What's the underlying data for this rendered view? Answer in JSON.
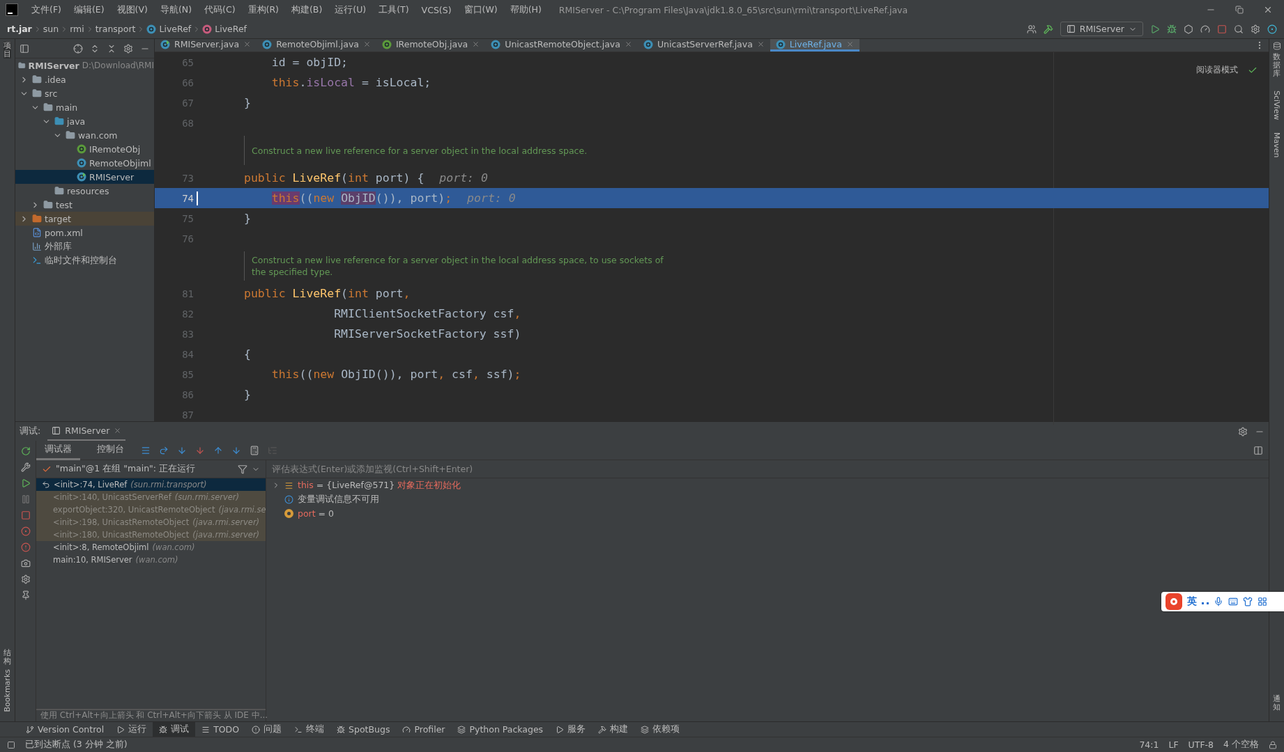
{
  "menu": {
    "items": [
      "文件(F)",
      "编辑(E)",
      "视图(V)",
      "导航(N)",
      "代码(C)",
      "重构(R)",
      "构建(B)",
      "运行(U)",
      "工具(T)",
      "VCS(S)",
      "窗口(W)",
      "帮助(H)"
    ],
    "title": "RMIServer - C:\\Program Files\\Java\\jdk1.8.0_65\\src\\sun\\rmi\\transport\\LiveRef.java"
  },
  "breadcrumb": [
    {
      "kind": "jar",
      "label": "rt.jar"
    },
    {
      "kind": "plain",
      "label": "sun"
    },
    {
      "kind": "plain",
      "label": "rmi"
    },
    {
      "kind": "plain",
      "label": "transport"
    },
    {
      "kind": "class",
      "label": "LiveRef"
    },
    {
      "kind": "method",
      "label": "LiveRef"
    }
  ],
  "run_config": "RMIServer",
  "left_strip": {
    "top": "项目",
    "middle": "结构",
    "bottom": "Bookmarks"
  },
  "right_strip": [
    "数据库",
    "SciView",
    "Maven"
  ],
  "right_notify": "通知",
  "project": {
    "root": {
      "label": "RMIServer",
      "path": "D:\\Download\\RMI"
    },
    "tree": [
      {
        "label": ".idea",
        "kind": "folder",
        "expanded": false,
        "selected": false
      },
      {
        "label": "src",
        "kind": "folder",
        "expanded": true,
        "selected": false,
        "children": [
          {
            "label": "main",
            "kind": "folder",
            "expanded": true,
            "selected": false,
            "children": [
              {
                "label": "java",
                "kind": "source",
                "expanded": true,
                "selected": false,
                "children": [
                  {
                    "label": "wan.com",
                    "kind": "package",
                    "expanded": true,
                    "selected": false,
                    "children": [
                      {
                        "label": "IRemoteObj",
                        "kind": "interface",
                        "selected": false
                      },
                      {
                        "label": "RemoteObjiml",
                        "kind": "class",
                        "selected": false
                      },
                      {
                        "label": "RMIServer",
                        "kind": "main",
                        "selected": true
                      }
                    ]
                  }
                ]
              },
              {
                "label": "resources",
                "kind": "resources",
                "selected": false
              }
            ]
          },
          {
            "label": "test",
            "kind": "folder",
            "expanded": false,
            "selected": false
          }
        ]
      },
      {
        "label": "target",
        "kind": "excluded",
        "expanded": false,
        "selected": false
      },
      {
        "label": "pom.xml",
        "kind": "maven",
        "selected": false
      },
      {
        "label": "外部库",
        "kind": "library",
        "selected": false
      },
      {
        "label": "临时文件和控制台",
        "kind": "scratch",
        "selected": false
      }
    ]
  },
  "tabs": [
    {
      "label": "RMIServer.java",
      "kind": "main",
      "selected": false
    },
    {
      "label": "RemoteObjiml.java",
      "kind": "class",
      "selected": false
    },
    {
      "label": "IRemoteObj.java",
      "kind": "interface",
      "selected": false
    },
    {
      "label": "UnicastRemoteObject.java",
      "kind": "class",
      "selected": false
    },
    {
      "label": "UnicastServerRef.java",
      "kind": "class",
      "selected": false
    },
    {
      "label": "LiveRef.java",
      "kind": "class",
      "selected": true
    }
  ],
  "reader_mode": "阅读器模式",
  "code_lines": [
    {
      "number": "65",
      "selected": false,
      "tokens": [
        {
          "kind": "plain",
          "text": "    id = objID;"
        }
      ]
    },
    {
      "number": "66",
      "selected": false,
      "tokens": [
        {
          "kind": "kw",
          "text": "    this"
        },
        {
          "kind": "plain",
          "text": "."
        },
        {
          "kind": "field",
          "text": "isLocal"
        },
        {
          "kind": "plain",
          "text": " = isLocal;"
        }
      ]
    },
    {
      "number": "67",
      "selected": false,
      "tokens": [
        {
          "kind": "plain",
          "text": "}"
        }
      ]
    },
    {
      "number": "68",
      "selected": false
    },
    {
      "kind": "doc",
      "text": "Construct a new live reference for a server object in the local address space."
    },
    {
      "number": "73",
      "selected": false,
      "tokens": [
        {
          "kind": "kw",
          "text": "public "
        },
        {
          "kind": "decl",
          "text": "LiveRef"
        },
        {
          "kind": "plain",
          "text": "("
        },
        {
          "kind": "kw",
          "text": "int "
        },
        {
          "kind": "plain",
          "text": "port) {"
        },
        {
          "kind": "hint",
          "text": "port: 0"
        }
      ]
    },
    {
      "number": "74",
      "selected": true,
      "tokens": [
        {
          "kind": "kw-hl",
          "text": "    this"
        },
        {
          "kind": "plain",
          "text": "(("
        },
        {
          "kind": "kw",
          "text": "new "
        },
        {
          "kind": "type-hl",
          "text": "ObjID"
        },
        {
          "kind": "plain",
          "text": "()), port)"
        },
        {
          "kind": "kw",
          "text": ";"
        },
        {
          "kind": "hint",
          "text": "port: 0"
        }
      ]
    },
    {
      "number": "75",
      "selected": false,
      "tokens": [
        {
          "kind": "plain",
          "text": "}"
        }
      ]
    },
    {
      "number": "76",
      "selected": false
    },
    {
      "kind": "doc",
      "text": "Construct a new live reference for a server object in the local address space, to use sockets of the specified type."
    },
    {
      "number": "81",
      "selected": false,
      "tokens": [
        {
          "kind": "kw",
          "text": "public "
        },
        {
          "kind": "decl",
          "text": "LiveRef"
        },
        {
          "kind": "plain",
          "text": "("
        },
        {
          "kind": "kw",
          "text": "int "
        },
        {
          "kind": "plain",
          "text": "port"
        },
        {
          "kind": "kw",
          "text": ","
        }
      ]
    },
    {
      "number": "82",
      "selected": false,
      "tokens": [
        {
          "kind": "plain",
          "text": "             RMIClientSocketFactory csf"
        },
        {
          "kind": "kw",
          "text": ","
        }
      ]
    },
    {
      "number": "83",
      "selected": false,
      "tokens": [
        {
          "kind": "plain",
          "text": "             RMIServerSocketFactory ssf)"
        }
      ]
    },
    {
      "number": "84",
      "selected": false,
      "tokens": [
        {
          "kind": "plain",
          "text": "{"
        }
      ]
    },
    {
      "number": "85",
      "selected": false,
      "tokens": [
        {
          "kind": "kw",
          "text": "    this"
        },
        {
          "kind": "plain",
          "text": "(("
        },
        {
          "kind": "kw",
          "text": "new "
        },
        {
          "kind": "plain",
          "text": "ObjID()), port"
        },
        {
          "kind": "kw",
          "text": ", "
        },
        {
          "kind": "plain",
          "text": "csf"
        },
        {
          "kind": "kw",
          "text": ", "
        },
        {
          "kind": "plain",
          "text": "ssf)"
        },
        {
          "kind": "kw",
          "text": ";"
        }
      ]
    },
    {
      "number": "86",
      "selected": false,
      "tokens": [
        {
          "kind": "plain",
          "text": "}"
        }
      ]
    },
    {
      "number": "87",
      "selected": false
    }
  ],
  "debug": {
    "label": "调试:",
    "session": "RMIServer",
    "tabs": [
      {
        "label": "调试器",
        "selected": true
      },
      {
        "label": "控制台",
        "selected": false
      }
    ],
    "thread": "\"main\"@1 在组 \"main\": 正在运行",
    "frames": [
      {
        "method": "<init>:74, LiveRef",
        "package": "(sun.rmi.transport)",
        "selected": true,
        "library": false
      },
      {
        "method": "<init>:140, UnicastServerRef",
        "package": "(sun.rmi.server)",
        "selected": false,
        "library": true
      },
      {
        "method": "exportObject:320, UnicastRemoteObject",
        "package": "(java.rmi.se",
        "selected": false,
        "library": true
      },
      {
        "method": "<init>:198, UnicastRemoteObject",
        "package": "(java.rmi.server)",
        "selected": false,
        "library": true
      },
      {
        "method": "<init>:180, UnicastRemoteObject",
        "package": "(java.rmi.server)",
        "selected": false,
        "library": true
      },
      {
        "method": "<init>:8, RemoteObjiml",
        "package": "(wan.com)",
        "selected": false,
        "library": false
      },
      {
        "method": "main:10, RMIServer",
        "package": "(wan.com)",
        "selected": false,
        "library": false
      }
    ],
    "frames_hint": "使用 Ctrl+Alt+向上箭头 和 Ctrl+Alt+向下箭头 从 IDE 中...",
    "eval_placeholder": "评估表达式(Enter)或添加监视(Ctrl+Shift+Enter)",
    "variables": [
      {
        "kind": "object",
        "name": "this",
        "value": "= {LiveRef@571}",
        "note": "对象正在初始化",
        "expanded": false
      },
      {
        "kind": "info",
        "text": "变量调试信息不可用"
      },
      {
        "kind": "param",
        "name": "port",
        "value": "= 0"
      }
    ]
  },
  "ime": {
    "language": "英"
  },
  "tool_windows": [
    {
      "label": "Version Control",
      "selected": false
    },
    {
      "label": "运行",
      "selected": false
    },
    {
      "label": "调试",
      "selected": true
    },
    {
      "label": "TODO",
      "selected": false
    },
    {
      "label": "问题",
      "selected": false
    },
    {
      "label": "终端",
      "selected": false
    },
    {
      "label": "SpotBugs",
      "selected": false
    },
    {
      "label": "Profiler",
      "selected": false
    },
    {
      "label": "Python Packages",
      "selected": false
    },
    {
      "label": "服务",
      "selected": false
    },
    {
      "label": "构建",
      "selected": false
    },
    {
      "label": "依赖项",
      "selected": false
    }
  ],
  "status": {
    "message": "已到达断点 (3 分钟 之前)",
    "items": [
      "74:1",
      "LF",
      "UTF-8",
      "4 个空格"
    ]
  }
}
